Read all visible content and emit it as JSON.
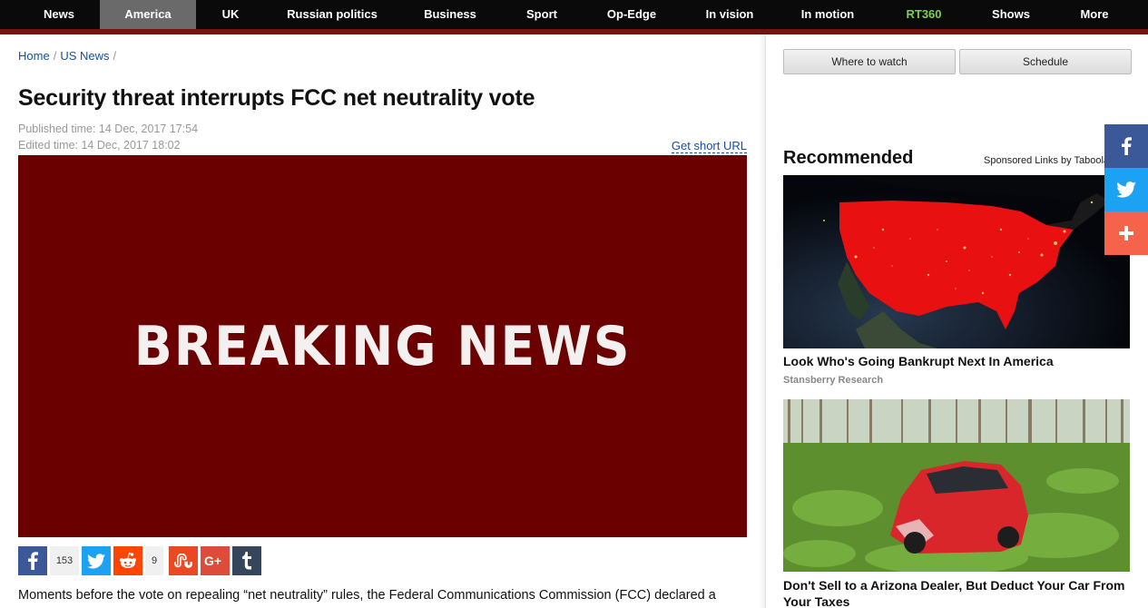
{
  "nav": {
    "items": [
      {
        "label": "News"
      },
      {
        "label": "America"
      },
      {
        "label": "UK"
      },
      {
        "label": "Russian politics"
      },
      {
        "label": "Business"
      },
      {
        "label": "Sport"
      },
      {
        "label": "Op-Edge"
      },
      {
        "label": "In vision"
      },
      {
        "label": "In motion"
      },
      {
        "label": "RT360"
      },
      {
        "label": "Shows"
      },
      {
        "label": "More"
      }
    ],
    "active": "America",
    "rt360_color": "#7ccf4a"
  },
  "breadcrumb": {
    "home": "Home",
    "section": "US News",
    "separator": "/"
  },
  "article": {
    "title": "Security threat interrupts FCC net neutrality vote",
    "published": "Published time: 14 Dec, 2017 17:54",
    "edited": "Edited time: 14 Dec, 2017 18:02",
    "short_url_label": "Get short URL",
    "hero_text": "BREAKING NEWS",
    "hero_color": "#6b0000",
    "body_first_line": "Moments before the vote on repealing “net neutrality” rules, the Federal Communications Commission (FCC) declared a"
  },
  "share": {
    "facebook_count": "153",
    "reddit_count": "9",
    "buttons": [
      "facebook-icon",
      "twitter-icon",
      "reddit-icon",
      "stumbleupon-icon",
      "google-plus-icon",
      "tumblr-icon"
    ]
  },
  "sidebar": {
    "where_to_watch": "Where to watch",
    "schedule": "Schedule",
    "recommended_title": "Recommended",
    "sponsored": "Sponsored Links by Taboola",
    "items": [
      {
        "headline": "Look Who's Going Bankrupt Next In America",
        "source": "Stansberry Research"
      },
      {
        "headline": "Don't Sell to a Arizona Dealer, But Deduct Your Car From Your Taxes",
        "source": ""
      }
    ]
  },
  "floating_share": {
    "buttons": [
      "facebook-icon",
      "twitter-icon",
      "plus-icon"
    ],
    "colors": {
      "facebook": "#3b5998",
      "twitter": "#1da1f2",
      "plus": "#f5634a"
    }
  }
}
